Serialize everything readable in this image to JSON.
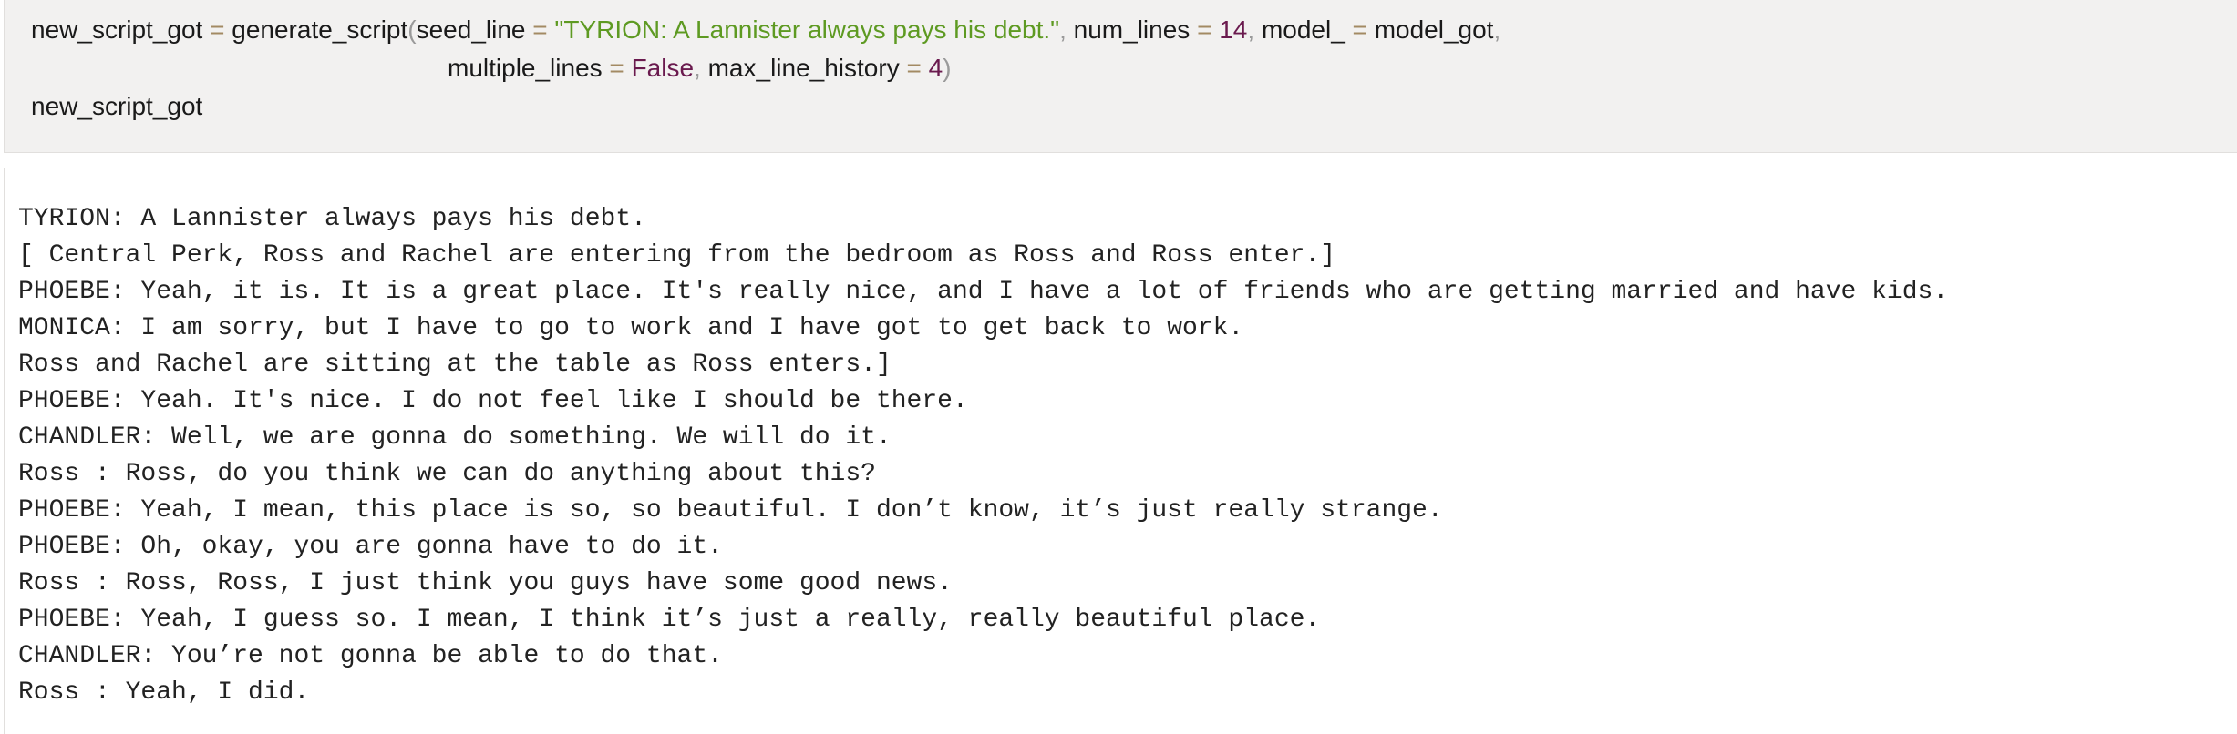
{
  "code_cell": {
    "line1": {
      "var": "new_script_got",
      "eq1": " = ",
      "fn": "generate_script",
      "paren_open": "(",
      "arg1_name": "seed_line",
      "eq2": " = ",
      "arg1_value": "\"TYRION: A Lannister always pays his debt.\"",
      "comma1": ", ",
      "arg2_name": "num_lines",
      "eq3": " = ",
      "arg2_value": "14",
      "comma2": ", ",
      "arg3_name": "model_",
      "eq4": " = ",
      "arg3_value": "model_got",
      "comma3": ","
    },
    "line2": {
      "arg4_name": "multiple_lines",
      "eq5": " = ",
      "arg4_value": "False",
      "comma4": ", ",
      "arg5_name": "max_line_history",
      "eq6": " = ",
      "arg5_value": "4",
      "paren_close": ")"
    },
    "line3": {
      "var": "new_script_got"
    }
  },
  "output": {
    "lines": [
      "TYRION: A Lannister always pays his debt.",
      "[ Central Perk, Ross and Rachel are entering from the bedroom as Ross and Ross enter.]",
      "PHOEBE: Yeah, it is. It is a great place. It's really nice, and I have a lot of friends who are getting married and have kids.",
      "MONICA: I am sorry, but I have to go to work and I have got to get back to work.",
      "Ross and Rachel are sitting at the table as Ross enters.]",
      "PHOEBE: Yeah. It's nice. I do not feel like I should be there.",
      "CHANDLER: Well, we are gonna do something. We will do it.",
      "Ross : Ross, do you think we can do anything about this?",
      "PHOEBE: Yeah, I mean, this place is so, so beautiful. I don’t know, it’s just really strange.",
      "PHOEBE: Oh, okay, you are gonna have to do it.",
      "Ross : Ross, Ross, I just think you guys have some good news.",
      "PHOEBE: Yeah, I guess so. I mean, I think it’s just a really, really beautiful place.",
      "CHANDLER: You’re not gonna be able to do that.",
      "Ross : Yeah, I did."
    ]
  },
  "colors": {
    "code_background": "#f2f1f0",
    "operator": "#a38a63",
    "string": "#5e9a22",
    "number": "#6a1a4e",
    "keyword": "#6a1a4e"
  }
}
